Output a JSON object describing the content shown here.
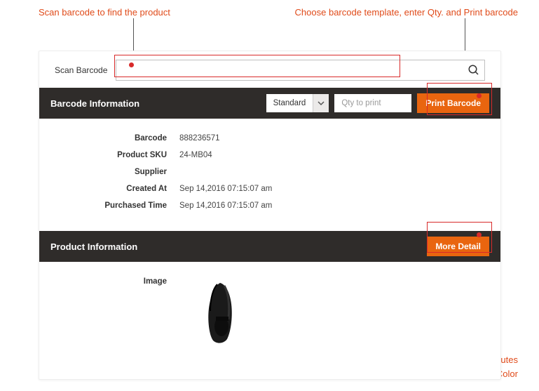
{
  "annotations": {
    "top_left": "Scan barcode to find the product",
    "top_right": "Choose barcode template, enter Qty. and Print barcode",
    "bottom": "Click on More Detail to view and edit product attributes\nlike Price, Material, SKU and Color"
  },
  "scan": {
    "label": "Scan Barcode",
    "placeholder": ""
  },
  "barcode_section": {
    "title": "Barcode Information",
    "template_selected": "Standard",
    "qty_placeholder": "Qty to print",
    "print_button": "Print Barcode",
    "rows": [
      {
        "label": "Barcode",
        "value": "888236571"
      },
      {
        "label": "Product SKU",
        "value": "24-MB04"
      },
      {
        "label": "Supplier",
        "value": ""
      },
      {
        "label": "Created At",
        "value": "Sep 14,2016 07:15:07 am"
      },
      {
        "label": "Purchased Time",
        "value": "Sep 14,2016 07:15:07 am"
      }
    ]
  },
  "product_section": {
    "title": "Product Information",
    "more_button": "More Detail",
    "image_label": "Image"
  }
}
